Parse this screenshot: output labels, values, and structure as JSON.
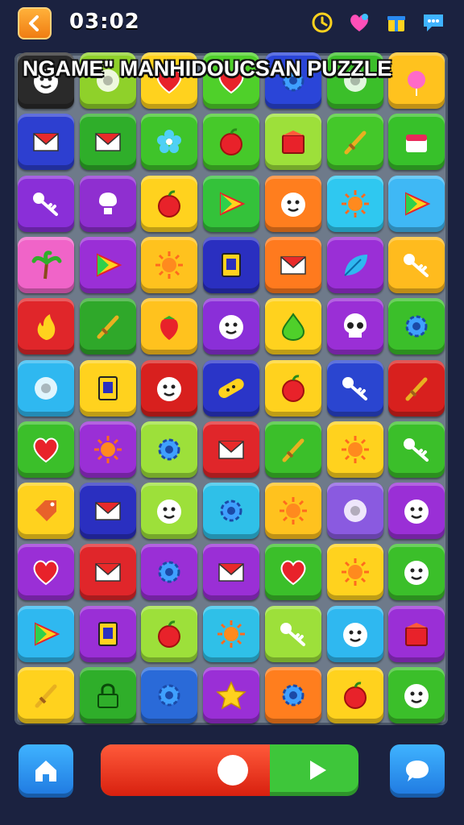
{
  "topbar": {
    "timer": "03:02",
    "icons": [
      "back-arrow-icon",
      "clock-icon",
      "heart-gem-icon",
      "gift-icon",
      "chat-bubble-icon"
    ]
  },
  "game": {
    "title": "NGAME\" MANHIDOUCSAN PUZZLE",
    "columns": 7,
    "rows": 11,
    "tiles": [
      {
        "color": "#2a2a2a",
        "icon": "face"
      },
      {
        "color": "#8fd12a",
        "icon": "circle"
      },
      {
        "color": "#ffd21e",
        "icon": "heart"
      },
      {
        "color": "#4fd02a",
        "icon": "heart"
      },
      {
        "color": "#2a45d8",
        "icon": "gear"
      },
      {
        "color": "#3bbf2a",
        "icon": "circle"
      },
      {
        "color": "#ffc21e",
        "icon": "ball"
      },
      {
        "color": "#2d3fd0",
        "icon": "envelope"
      },
      {
        "color": "#2fae2a",
        "icon": "envelope"
      },
      {
        "color": "#3fc42a",
        "icon": "flower"
      },
      {
        "color": "#46c92a",
        "icon": "apple"
      },
      {
        "color": "#9de03a",
        "icon": "gift"
      },
      {
        "color": "#44c82a",
        "icon": "sword"
      },
      {
        "color": "#37c12a",
        "icon": "cake"
      },
      {
        "color": "#8a2fd8",
        "icon": "key"
      },
      {
        "color": "#8f2fd0",
        "icon": "bulb"
      },
      {
        "color": "#ffd21e",
        "icon": "apple"
      },
      {
        "color": "#34c23a",
        "icon": "triangle"
      },
      {
        "color": "#ff7e1e",
        "icon": "face"
      },
      {
        "color": "#2fc8f0",
        "icon": "sun"
      },
      {
        "color": "#3fb8f5",
        "icon": "triangle"
      },
      {
        "color": "#f064c8",
        "icon": "palm"
      },
      {
        "color": "#9a2fd6",
        "icon": "triangle"
      },
      {
        "color": "#ffc21e",
        "icon": "sun"
      },
      {
        "color": "#2a2fc0",
        "icon": "box"
      },
      {
        "color": "#ff7a1e",
        "icon": "envelope"
      },
      {
        "color": "#9a2fd6",
        "icon": "leaf"
      },
      {
        "color": "#ffbb1e",
        "icon": "key"
      },
      {
        "color": "#e0262a",
        "icon": "flame"
      },
      {
        "color": "#2fa82a",
        "icon": "sword"
      },
      {
        "color": "#ffc21e",
        "icon": "strawberry"
      },
      {
        "color": "#8a2fd8",
        "icon": "face"
      },
      {
        "color": "#ffd21e",
        "icon": "drop"
      },
      {
        "color": "#9a2fd6",
        "icon": "skull"
      },
      {
        "color": "#3bbf2a",
        "icon": "gear"
      },
      {
        "color": "#2fb8f0",
        "icon": "circle"
      },
      {
        "color": "#ffd21e",
        "icon": "box"
      },
      {
        "color": "#d8201e",
        "icon": "face"
      },
      {
        "color": "#2a35c8",
        "icon": "bandage"
      },
      {
        "color": "#ffd21e",
        "icon": "apple"
      },
      {
        "color": "#2a45d0",
        "icon": "key"
      },
      {
        "color": "#d8201e",
        "icon": "sword"
      },
      {
        "color": "#3bbf2a",
        "icon": "heart"
      },
      {
        "color": "#9a2fd6",
        "icon": "sun"
      },
      {
        "color": "#9de03a",
        "icon": "gear"
      },
      {
        "color": "#e0262a",
        "icon": "envelope"
      },
      {
        "color": "#3bbf2a",
        "icon": "sword"
      },
      {
        "color": "#ffd21e",
        "icon": "sun"
      },
      {
        "color": "#3bbf2a",
        "icon": "key"
      },
      {
        "color": "#ffd21e",
        "icon": "tag"
      },
      {
        "color": "#2a2fc0",
        "icon": "envelope"
      },
      {
        "color": "#9de03a",
        "icon": "face"
      },
      {
        "color": "#2fc0e8",
        "icon": "gear"
      },
      {
        "color": "#ffc21e",
        "icon": "sun"
      },
      {
        "color": "#8a5ae0",
        "icon": "circle"
      },
      {
        "color": "#9a2fd6",
        "icon": "face"
      },
      {
        "color": "#9a2fd6",
        "icon": "heart"
      },
      {
        "color": "#e0262a",
        "icon": "envelope"
      },
      {
        "color": "#9a2fd6",
        "icon": "gear"
      },
      {
        "color": "#9a2fd6",
        "icon": "envelope"
      },
      {
        "color": "#3bbf2a",
        "icon": "heart"
      },
      {
        "color": "#ffd21e",
        "icon": "sun"
      },
      {
        "color": "#3bbf2a",
        "icon": "face"
      },
      {
        "color": "#2fb8f0",
        "icon": "triangle"
      },
      {
        "color": "#9a2fd6",
        "icon": "box"
      },
      {
        "color": "#9de03a",
        "icon": "apple"
      },
      {
        "color": "#2fc0e8",
        "icon": "sun"
      },
      {
        "color": "#9de03a",
        "icon": "key"
      },
      {
        "color": "#2fb8f0",
        "icon": "face"
      },
      {
        "color": "#9a2fd6",
        "icon": "gift"
      },
      {
        "color": "#ffd21e",
        "icon": "sword"
      },
      {
        "color": "#2fae2a",
        "icon": "lock"
      },
      {
        "color": "#2a6ad8",
        "icon": "gear"
      },
      {
        "color": "#9a2fd6",
        "icon": "star"
      },
      {
        "color": "#ff7e1e",
        "icon": "gear"
      },
      {
        "color": "#ffd21e",
        "icon": "apple"
      },
      {
        "color": "#3bbf2a",
        "icon": "face"
      }
    ]
  },
  "bottombar": {
    "progress": 0.56,
    "icons": [
      "home-icon",
      "play-icon",
      "speech-bubble-icon"
    ]
  }
}
